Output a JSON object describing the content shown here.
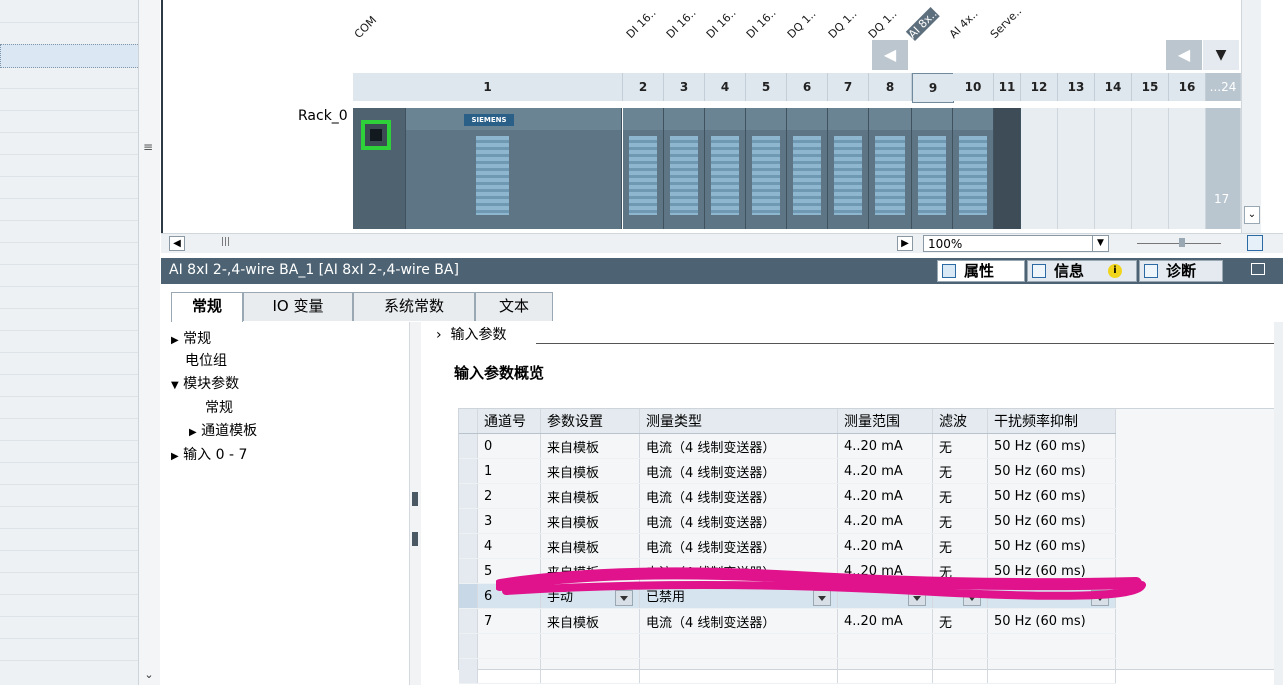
{
  "device_view": {
    "rack_label": "Rack_0",
    "module_names": [
      "COM",
      "DI 16..",
      "DI 16..",
      "DI 16..",
      "DI 16..",
      "DQ 1..",
      "DQ 1..",
      "DQ 1..",
      "AI 8x..",
      "AI 4x..",
      "Serve.."
    ],
    "slots": [
      "1",
      "2",
      "3",
      "4",
      "5",
      "6",
      "7",
      "8",
      "9",
      "10",
      "11",
      "12",
      "13",
      "14",
      "15",
      "16",
      "...24"
    ],
    "slot_number_17": "17",
    "zoom": "100%",
    "siemens_label": "SIEMENS"
  },
  "properties": {
    "title": "AI 8xI 2-,4-wire BA_1 [AI 8xI 2-,4-wire BA]",
    "right_tabs": [
      {
        "label": "属性",
        "icon": "properties-icon"
      },
      {
        "label": "信息",
        "icon": "info-icon"
      },
      {
        "label": "诊断",
        "icon": "diagnostics-icon"
      }
    ],
    "tabs": [
      "常规",
      "IO 变量",
      "系统常数",
      "文本"
    ]
  },
  "nav_tree": {
    "items": [
      "常规",
      "电位组",
      "模块参数",
      "常规",
      "通道模板",
      "输入 0 - 7"
    ]
  },
  "content": {
    "breadcrumb": "输入参数",
    "section_title": "输入参数概览",
    "table": {
      "headers": [
        "通道号",
        "参数设置",
        "测量类型",
        "测量范围",
        "滤波",
        "干扰频率抑制"
      ],
      "rows": [
        [
          "0",
          "来自模板",
          "电流（4 线制变送器）",
          "4..20 mA",
          "无",
          "50 Hz (60 ms)"
        ],
        [
          "1",
          "来自模板",
          "电流（4 线制变送器）",
          "4..20 mA",
          "无",
          "50 Hz (60 ms)"
        ],
        [
          "2",
          "来自模板",
          "电流（4 线制变送器）",
          "4..20 mA",
          "无",
          "50 Hz (60 ms)"
        ],
        [
          "3",
          "来自模板",
          "电流（4 线制变送器）",
          "4..20 mA",
          "无",
          "50 Hz (60 ms)"
        ],
        [
          "4",
          "来自模板",
          "电流（4 线制变送器）",
          "4..20 mA",
          "无",
          "50 Hz (60 ms)"
        ],
        [
          "5",
          "来自模板",
          "电流（4 线制变送器）",
          "4..20 mA",
          "无",
          "50 Hz (60 ms)"
        ],
        [
          "6",
          "手动",
          "已禁用",
          "",
          "",
          "",
          ""
        ],
        [
          "7",
          "来自模板",
          "电流（4 线制变送器）",
          "4..20 mA",
          "无",
          "50 Hz (60 ms)"
        ]
      ]
    },
    "highlight_color": "#e0138c"
  }
}
